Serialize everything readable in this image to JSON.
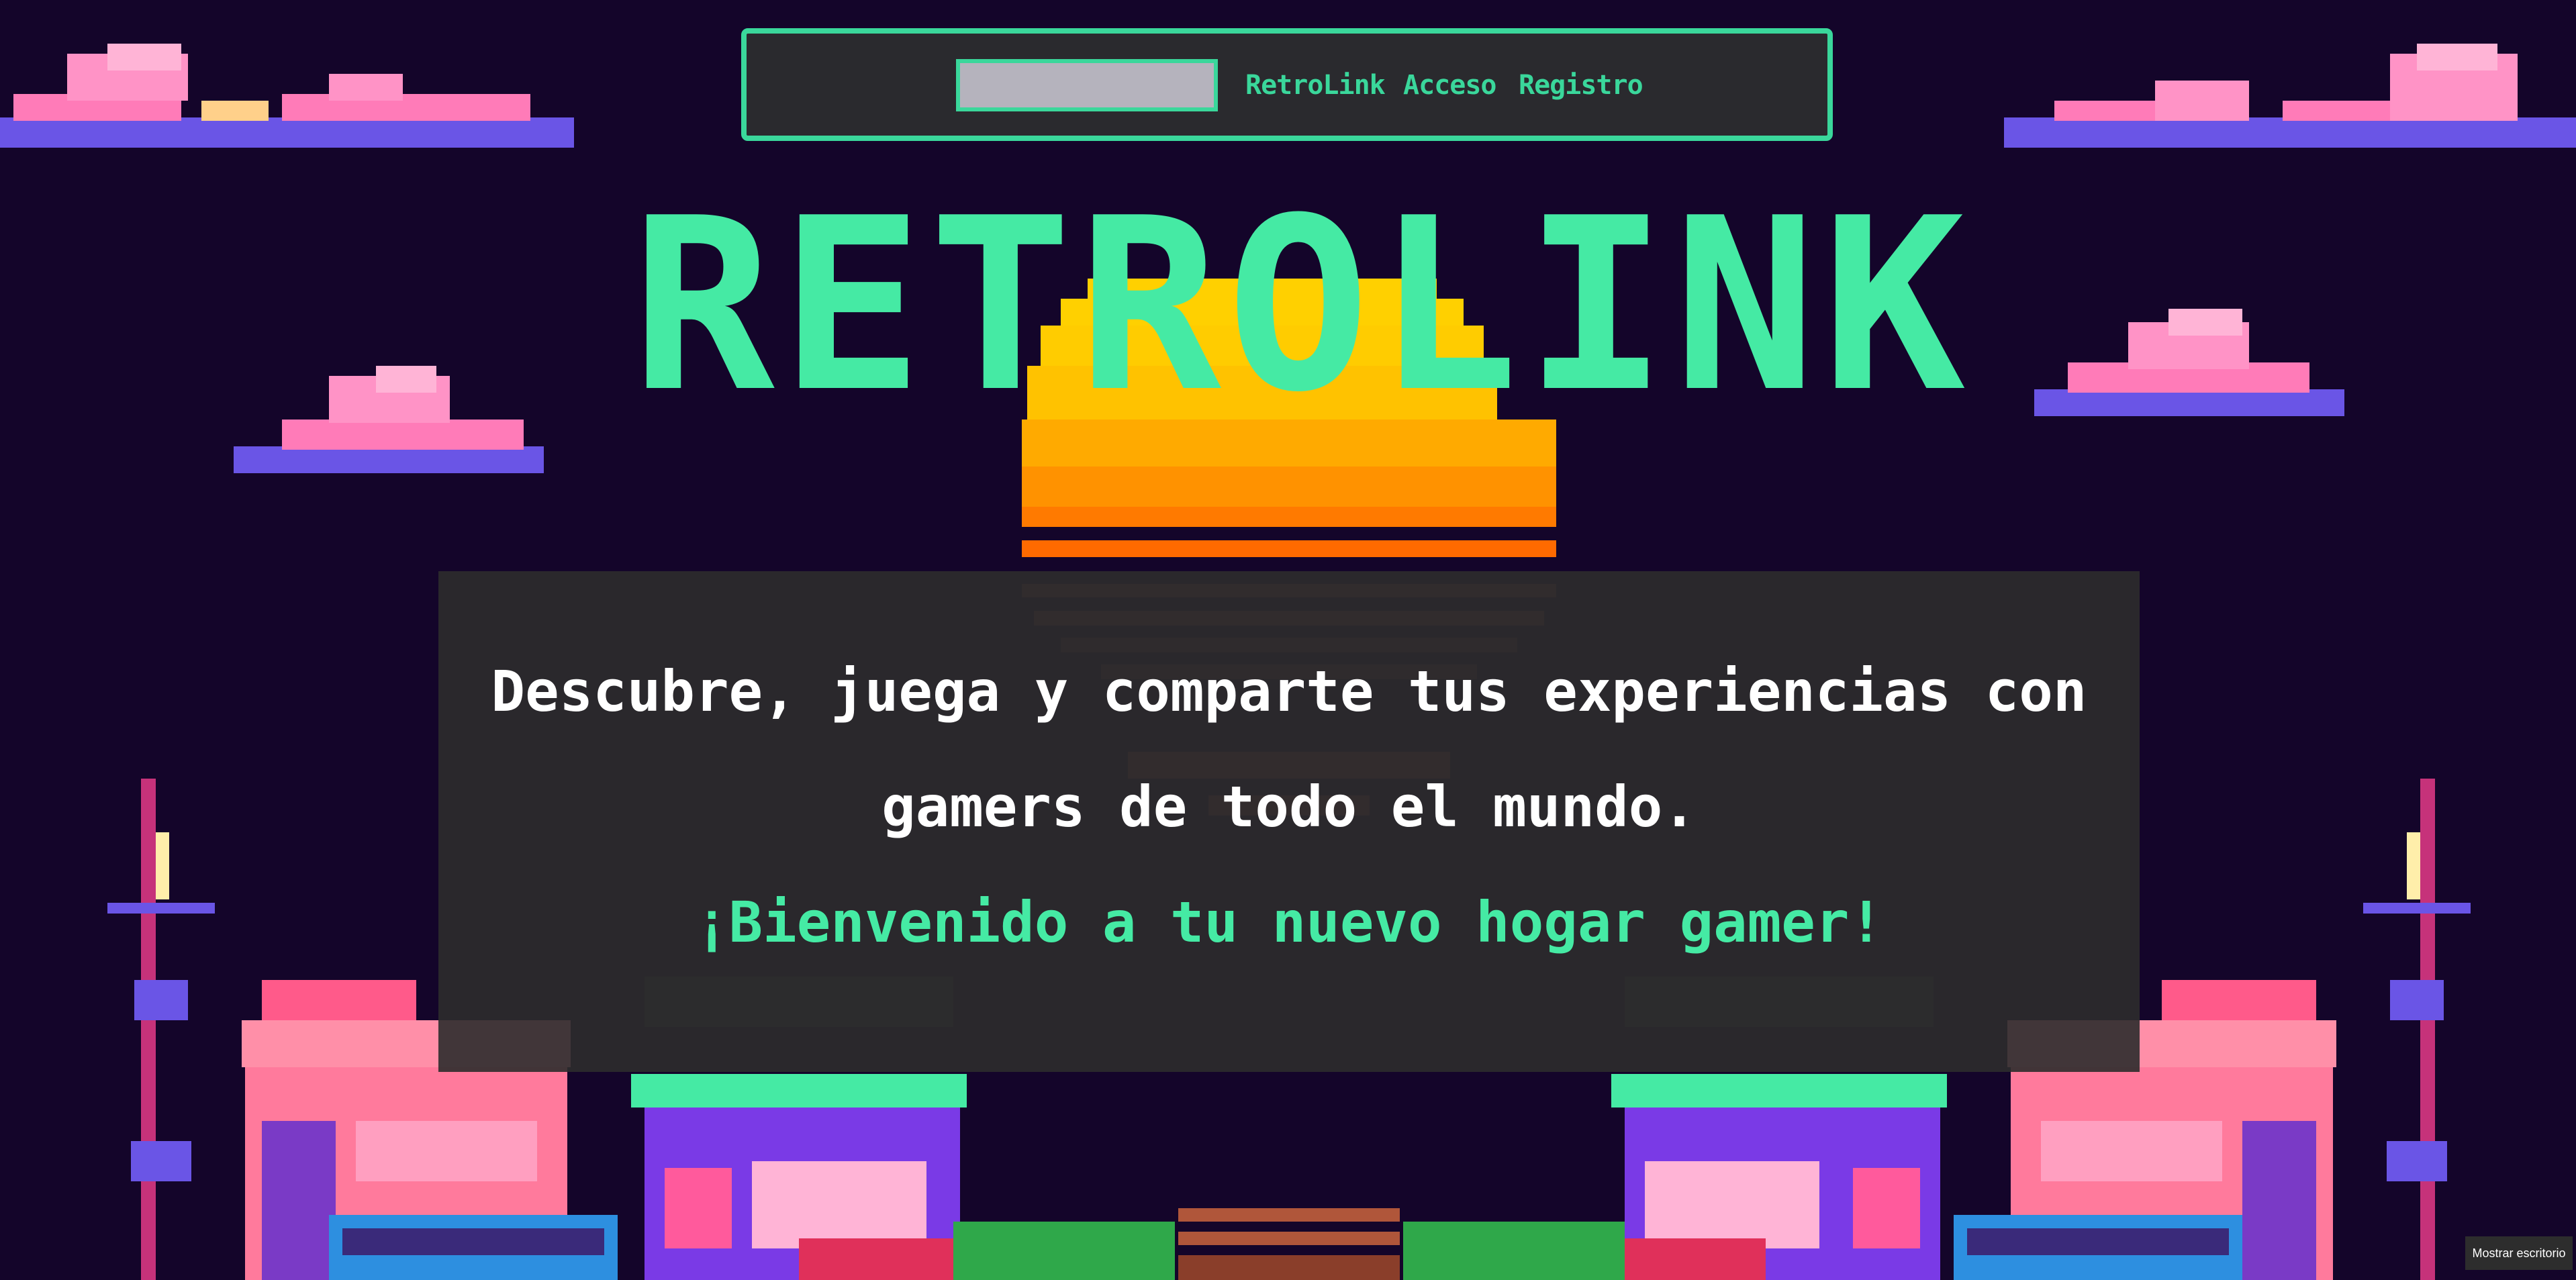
{
  "colors": {
    "background": "#14052a",
    "accent": "#45eaa4",
    "nav_border": "#3ad79b",
    "panel": "#2c2c2c",
    "sun": "#ffc400",
    "cloud_pink": "#ff7bb8",
    "cloud_purple": "#6a55e6"
  },
  "nav": {
    "search": {
      "value": "",
      "placeholder": ""
    },
    "links": [
      "RetroLink",
      "Acceso",
      "Registro"
    ]
  },
  "hero": {
    "logo": "RETROLINK",
    "line1": "Descubre, juega y comparte tus experiencias con",
    "line2": "gamers de todo el mundo.",
    "line3": "¡Bienvenido a tu nuevo hogar gamer!"
  },
  "taskbar": {
    "tooltip": "Mostrar escritorio"
  },
  "icons": [
    "cloud-icon",
    "sun-icon",
    "street-lamp-icon",
    "shop-icon",
    "bus-icon",
    "car-icon",
    "bench-icon",
    "bush-icon"
  ]
}
